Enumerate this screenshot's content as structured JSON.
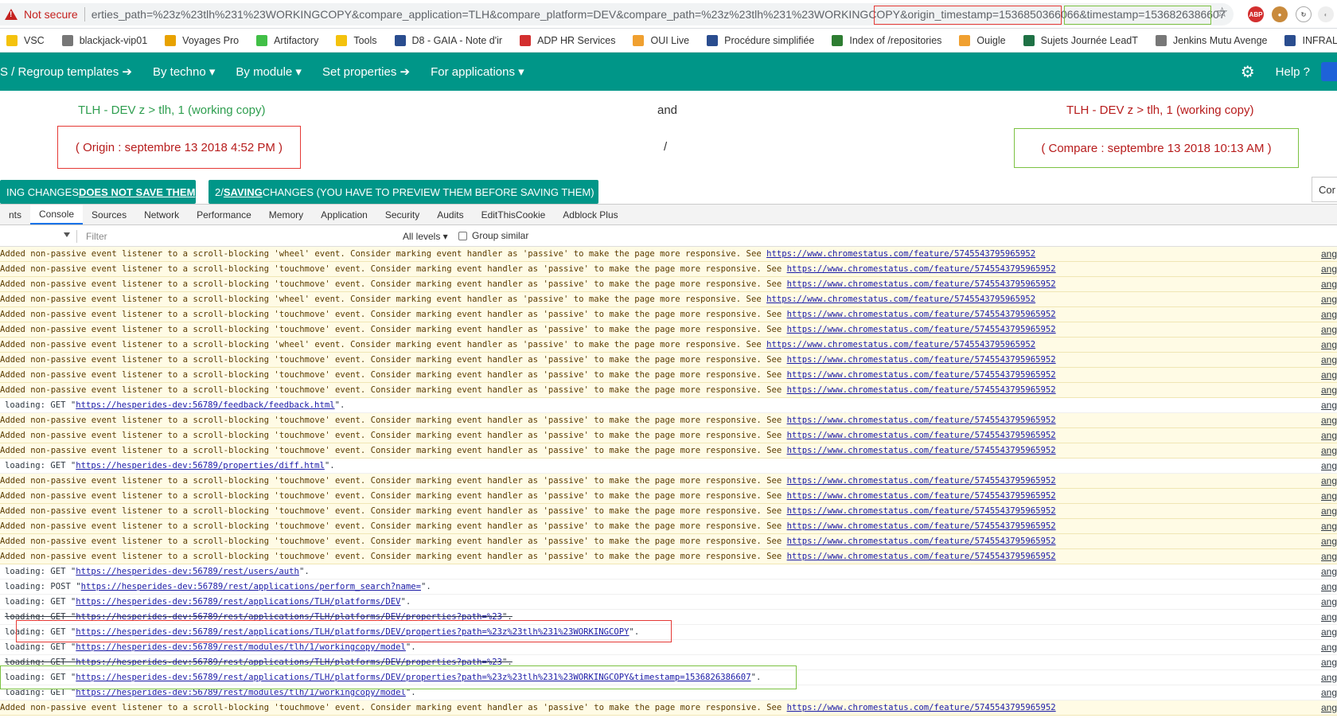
{
  "address_bar": {
    "security_label": "Not secure",
    "url": "erties_path=%23z%23tlh%231%23WORKINGCOPY&compare_application=TLH&compare_platform=DEV&compare_path=%23z%23tlh%231%23WORKINGCOPY&origin_timestamp=1536850366066&timestamp=1536826386607",
    "highlight_origin": "&origin_timestamp=1536850366066",
    "highlight_timestamp": "timestamp=1536826386607"
  },
  "bookmarks": [
    {
      "label": "VSC",
      "icon": "folder-icon"
    },
    {
      "label": "blackjack-vip01",
      "icon": "page-icon"
    },
    {
      "label": "Voyages Pro",
      "icon": "voyages-icon"
    },
    {
      "label": "Artifactory",
      "icon": "artifactory-icon"
    },
    {
      "label": "Tools",
      "icon": "folder-icon"
    },
    {
      "label": "D8 - GAIA - Note d'ir",
      "icon": "x-icon"
    },
    {
      "label": "ADP HR Services",
      "icon": "adp-icon"
    },
    {
      "label": "OUI Live",
      "icon": "oui-icon"
    },
    {
      "label": "Procédure simplifiée",
      "icon": "x-icon"
    },
    {
      "label": "Index of /repositories",
      "icon": "n-icon"
    },
    {
      "label": "Ouigle",
      "icon": "ouigle-icon"
    },
    {
      "label": "Sujets Journée LeadT",
      "icon": "excel-icon"
    },
    {
      "label": "Jenkins Mutu Avenge",
      "icon": "page-icon"
    },
    {
      "label": "INFRALIB - Infralib - \\",
      "icon": "x-icon"
    }
  ],
  "nav": {
    "items": [
      "S / Regroup templates ➔",
      "By techno ▾",
      "By module ▾",
      "Set properties ➔",
      "For applications ▾"
    ],
    "help": "Help ?"
  },
  "compare": {
    "left_title": "TLH - DEV z > tlh, 1 (working copy)",
    "and": "and",
    "right_title": "TLH - DEV z > tlh, 1 (working copy)",
    "origin": "( Origin : septembre 13 2018 4:52 PM )",
    "slash": "/",
    "compare": "( Compare : septembre 13 2018 10:13 AM )",
    "btn1_pre": "ING CHANGES ",
    "btn1_u": "DOES NOT SAVE THEM",
    "btn2_pre": "2/ ",
    "btn2_u": "SAVING ",
    "btn2_post": "CHANGES (YOU HAVE TO PREVIEW THEM BEFORE SAVING THEM)",
    "side_tab": "Cor"
  },
  "devtools": {
    "tabs": [
      "nts",
      "Console",
      "Sources",
      "Network",
      "Performance",
      "Memory",
      "Application",
      "Security",
      "Audits",
      "EditThisCookie",
      "Adblock Plus"
    ],
    "active_tab": "Console",
    "filter_placeholder": "Filter",
    "levels": "All levels ▾",
    "group_similar": "Group similar"
  },
  "console": {
    "src_label": "ang",
    "lines": [
      {
        "type": "warn",
        "event": "wheel",
        "text": "Added non-passive event listener to a scroll-blocking 'wheel' event. Consider marking event handler as 'passive' to make the page more responsive. See ",
        "link": "https://www.chromestatus.com/feature/5745543795965952"
      },
      {
        "type": "warn",
        "event": "touchmove",
        "text": " Added non-passive event listener to a scroll-blocking 'touchmove' event. Consider marking event handler as 'passive' to make the page more responsive. See ",
        "link": "https://www.chromestatus.com/feature/5745543795965952"
      },
      {
        "type": "warn",
        "event": "touchmove",
        "text": "Added non-passive event listener to a scroll-blocking 'touchmove' event. Consider marking event handler as 'passive' to make the page more responsive. See ",
        "link": "https://www.chromestatus.com/feature/5745543795965952"
      },
      {
        "type": "warn",
        "event": "wheel",
        "text": "Added non-passive event listener to a scroll-blocking 'wheel' event. Consider marking event handler as 'passive' to make the page more responsive. See ",
        "link": "https://www.chromestatus.com/feature/5745543795965952"
      },
      {
        "type": "warn",
        "event": "touchmove",
        "text": " Added non-passive event listener to a scroll-blocking 'touchmove' event. Consider marking event handler as 'passive' to make the page more responsive. See ",
        "link": "https://www.chromestatus.com/feature/5745543795965952"
      },
      {
        "type": "warn",
        "event": "touchmove",
        "text": "Added non-passive event listener to a scroll-blocking 'touchmove' event. Consider marking event handler as 'passive' to make the page more responsive. See ",
        "link": "https://www.chromestatus.com/feature/5745543795965952"
      },
      {
        "type": "warn",
        "event": "wheel",
        "text": "Added non-passive event listener to a scroll-blocking 'wheel' event. Consider marking event handler as 'passive' to make the page more responsive. See ",
        "link": "https://www.chromestatus.com/feature/5745543795965952"
      },
      {
        "type": "warn",
        "event": "touchmove",
        "text": " Added non-passive event listener to a scroll-blocking 'touchmove' event. Consider marking event handler as 'passive' to make the page more responsive. See ",
        "link": "https://www.chromestatus.com/feature/5745543795965952"
      },
      {
        "type": "warn",
        "event": "touchmove",
        "text": "Added non-passive event listener to a scroll-blocking 'touchmove' event. Consider marking event handler as 'passive' to make the page more responsive. See ",
        "link": "https://www.chromestatus.com/feature/5745543795965952"
      },
      {
        "type": "warn",
        "event": "touchmove",
        "text": "Added non-passive event listener to a scroll-blocking 'touchmove' event. Consider marking event handler as 'passive' to make the page more responsive. See ",
        "link": "https://www.chromestatus.com/feature/5745543795965952"
      },
      {
        "type": "info",
        "text": "loading: GET \"",
        "link": "https://hesperides-dev:56789/feedback/feedback.html",
        "tail": "\"."
      },
      {
        "type": "warn",
        "event": "touchmove",
        "text": " Added non-passive event listener to a scroll-blocking 'touchmove' event. Consider marking event handler as 'passive' to make the page more responsive. See ",
        "link": "https://www.chromestatus.com/feature/5745543795965952"
      },
      {
        "type": "warn",
        "event": "touchmove",
        "text": " Added non-passive event listener to a scroll-blocking 'touchmove' event. Consider marking event handler as 'passive' to make the page more responsive. See ",
        "link": "https://www.chromestatus.com/feature/5745543795965952"
      },
      {
        "type": "warn",
        "event": "touchmove",
        "text": "Added non-passive event listener to a scroll-blocking 'touchmove' event. Consider marking event handler as 'passive' to make the page more responsive. See ",
        "link": "https://www.chromestatus.com/feature/5745543795965952"
      },
      {
        "type": "info",
        "text": "loading: GET \"",
        "link": "https://hesperides-dev:56789/properties/diff.html",
        "tail": "\"."
      },
      {
        "type": "warn",
        "event": "touchmove",
        "text": "Added non-passive event listener to a scroll-blocking 'touchmove' event. Consider marking event handler as 'passive' to make the page more responsive. See ",
        "link": "https://www.chromestatus.com/feature/5745543795965952"
      },
      {
        "type": "warn",
        "event": "touchmove",
        "text": "Added non-passive event listener to a scroll-blocking 'touchmove' event. Consider marking event handler as 'passive' to make the page more responsive. See ",
        "link": "https://www.chromestatus.com/feature/5745543795965952"
      },
      {
        "type": "warn",
        "event": "touchmove",
        "text": "Added non-passive event listener to a scroll-blocking 'touchmove' event. Consider marking event handler as 'passive' to make the page more responsive. See ",
        "link": "https://www.chromestatus.com/feature/5745543795965952"
      },
      {
        "type": "warn",
        "event": "touchmove",
        "text": "Added non-passive event listener to a scroll-blocking 'touchmove' event. Consider marking event handler as 'passive' to make the page more responsive. See ",
        "link": "https://www.chromestatus.com/feature/5745543795965952"
      },
      {
        "type": "warn",
        "event": "touchmove",
        "text": "Added non-passive event listener to a scroll-blocking 'touchmove' event. Consider marking event handler as 'passive' to make the page more responsive. See ",
        "link": "https://www.chromestatus.com/feature/5745543795965952"
      },
      {
        "type": "warn",
        "event": "touchmove",
        "text": " Added non-passive event listener to a scroll-blocking 'touchmove' event. Consider marking event handler as 'passive' to make the page more responsive. See ",
        "link": "https://www.chromestatus.com/feature/5745543795965952"
      },
      {
        "type": "info",
        "text": "loading: GET \"",
        "link": "https://hesperides-dev:56789/rest/users/auth",
        "tail": "\"."
      },
      {
        "type": "info",
        "text": "loading: POST \"",
        "link": "https://hesperides-dev:56789/rest/applications/perform_search?name=",
        "tail": "\"."
      },
      {
        "type": "info",
        "text": "loading: GET \"",
        "link": "https://hesperides-dev:56789/rest/applications/TLH/platforms/DEV",
        "tail": "\"."
      },
      {
        "type": "info",
        "struck": true,
        "text": "loading: GET \"",
        "link": "https://hesperides-dev:56789/rest/applications/TLH/platforms/DEV/properties?path=%23",
        "tail": "\"."
      },
      {
        "type": "info",
        "text": "loading: GET \"",
        "link": "https://hesperides-dev:56789/rest/applications/TLH/platforms/DEV/properties?path=%23z%23tlh%231%23WORKINGCOPY",
        "tail": "\"."
      },
      {
        "type": "info",
        "text": "loading: GET \"",
        "link": "https://hesperides-dev:56789/rest/modules/tlh/1/workingcopy/model",
        "tail": "\"."
      },
      {
        "type": "info",
        "struck": true,
        "text": "loading: GET \"",
        "link": "https://hesperides-dev:56789/rest/applications/TLH/platforms/DEV/properties?path=%23",
        "tail": "\"."
      },
      {
        "type": "info",
        "text": "loading: GET \"",
        "link": "https://hesperides-dev:56789/rest/applications/TLH/platforms/DEV/properties?path=%23z%23tlh%231%23WORKINGCOPY&timestamp=1536826386607",
        "tail": "\"."
      },
      {
        "type": "info",
        "text": "loading: GET \"",
        "link": "https://hesperides-dev:56789/rest/modules/tlh/1/workingcopy/model",
        "tail": "\"."
      },
      {
        "type": "warn",
        "event": "touchmove",
        "text": " Added non-passive event listener to a scroll-blocking 'touchmove' event. Consider marking event handler as 'passive' to make the page more responsive. See ",
        "link": "https://www.chromestatus.com/feature/5745543795965952"
      }
    ]
  },
  "colors": {
    "teal": "#009688",
    "origin_red": "#e53935",
    "compare_green": "#7cc242"
  }
}
